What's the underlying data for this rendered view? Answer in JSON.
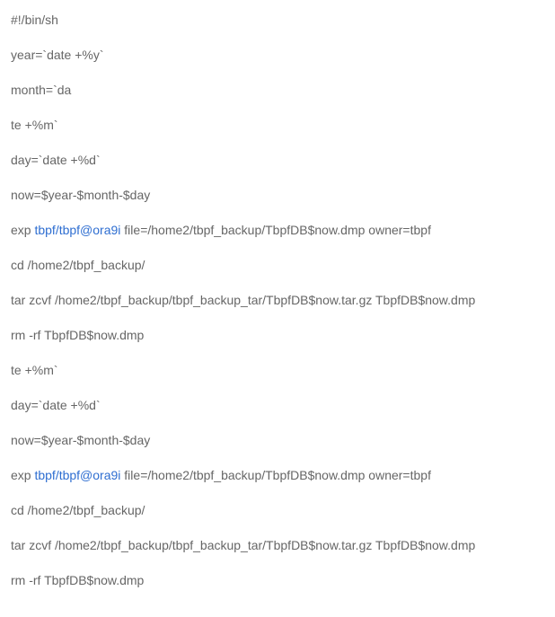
{
  "lines": [
    {
      "prefix": "#!/bin/sh",
      "link": "",
      "suffix": ""
    },
    {
      "prefix": "year=`date +%y`",
      "link": "",
      "suffix": ""
    },
    {
      "prefix": "month=`da",
      "link": "",
      "suffix": ""
    },
    {
      "prefix": "te +%m`",
      "link": "",
      "suffix": ""
    },
    {
      "prefix": "day=`date +%d`",
      "link": "",
      "suffix": ""
    },
    {
      "prefix": "now=$year-$month-$day",
      "link": "",
      "suffix": ""
    },
    {
      "prefix": "exp ",
      "link": "tbpf/tbpf@ora9i",
      "suffix": " file=/home2/tbpf_backup/TbpfDB$now.dmp owner=tbpf"
    },
    {
      "prefix": "cd /home2/tbpf_backup/",
      "link": "",
      "suffix": ""
    },
    {
      "prefix": "tar zcvf /home2/tbpf_backup/tbpf_backup_tar/TbpfDB$now.tar.gz TbpfDB$now.dmp",
      "link": "",
      "suffix": ""
    },
    {
      "prefix": "rm -rf TbpfDB$now.dmp",
      "link": "",
      "suffix": ""
    },
    {
      "prefix": "te +%m`",
      "link": "",
      "suffix": ""
    },
    {
      "prefix": "day=`date +%d`",
      "link": "",
      "suffix": ""
    },
    {
      "prefix": "now=$year-$month-$day",
      "link": "",
      "suffix": ""
    },
    {
      "prefix": "exp ",
      "link": "tbpf/tbpf@ora9i",
      "suffix": " file=/home2/tbpf_backup/TbpfDB$now.dmp owner=tbpf"
    },
    {
      "prefix": "cd /home2/tbpf_backup/",
      "link": "",
      "suffix": ""
    },
    {
      "prefix": "tar zcvf /home2/tbpf_backup/tbpf_backup_tar/TbpfDB$now.tar.gz TbpfDB$now.dmp",
      "link": "",
      "suffix": ""
    },
    {
      "prefix": "rm -rf TbpfDB$now.dmp",
      "link": "",
      "suffix": ""
    }
  ]
}
